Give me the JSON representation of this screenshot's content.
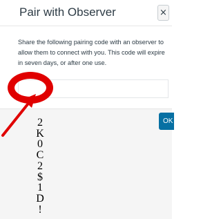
{
  "dialog": {
    "title": "Pair with Observer",
    "close_glyph": "×",
    "message": "Share the following pairing code with an observer to allow them to connect with you. This code will expire in seven days, or after one use.",
    "ok_label": "OK"
  },
  "annotation": {
    "code_chars": [
      "2",
      "K",
      "0",
      "C",
      "2",
      "$",
      "1",
      "D",
      "!"
    ],
    "circle_color": "#e00000",
    "arrow_color": "#e00000"
  },
  "colors": {
    "primary_button": "#0770a3",
    "footer_background": "#f5f5f5"
  }
}
